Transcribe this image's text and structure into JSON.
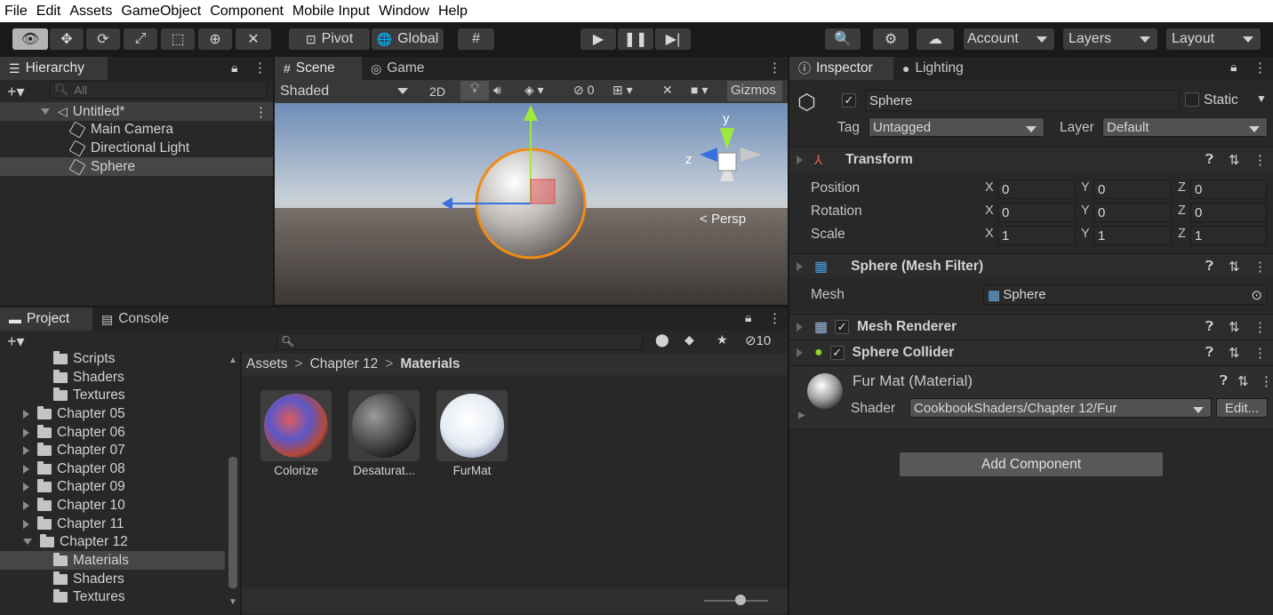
{
  "menu": [
    "File",
    "Edit",
    "Assets",
    "GameObject",
    "Component",
    "Mobile Input",
    "Window",
    "Help"
  ],
  "toolbar": {
    "pivot": "Pivot",
    "global": "Global",
    "account": "Account",
    "layers": "Layers",
    "layout": "Layout"
  },
  "hierarchy": {
    "tab": "Hierarchy",
    "search_placeholder": "All",
    "scene": "Untitled*",
    "items": [
      "Main Camera",
      "Directional Light",
      "Sphere"
    ]
  },
  "scene_view": {
    "tabs": [
      "Scene",
      "Game"
    ],
    "shading": "Shaded",
    "mode_2d": "2D",
    "hidden_count": "0",
    "gizmos": "Gizmos",
    "persp": "Persp",
    "axis_y": "y",
    "axis_z": "z"
  },
  "project": {
    "tabs": [
      "Project",
      "Console"
    ],
    "hidden_count": "10",
    "tree": [
      {
        "label": "Scripts",
        "level": 2
      },
      {
        "label": "Shaders",
        "level": 2
      },
      {
        "label": "Textures",
        "level": 2
      },
      {
        "label": "Chapter 05",
        "level": 1
      },
      {
        "label": "Chapter 06",
        "level": 1
      },
      {
        "label": "Chapter 07",
        "level": 1
      },
      {
        "label": "Chapter 08",
        "level": 1
      },
      {
        "label": "Chapter 09",
        "level": 1
      },
      {
        "label": "Chapter 10",
        "level": 1
      },
      {
        "label": "Chapter 11",
        "level": 1
      },
      {
        "label": "Chapter 12",
        "level": 1
      },
      {
        "label": "Materials",
        "level": 2
      },
      {
        "label": "Shaders",
        "level": 2
      },
      {
        "label": "Textures",
        "level": 2
      }
    ],
    "breadcrumb": [
      "Assets",
      "Chapter 12",
      "Materials"
    ],
    "assets": [
      "Colorize",
      "Desaturat...",
      "FurMat"
    ]
  },
  "inspector": {
    "tabs": [
      "Inspector",
      "Lighting"
    ],
    "object_name": "Sphere",
    "static_label": "Static",
    "tag_label": "Tag",
    "tag_value": "Untagged",
    "layer_label": "Layer",
    "layer_value": "Default",
    "transform": {
      "title": "Transform",
      "rows": [
        {
          "label": "Position",
          "x": "0",
          "y": "0",
          "z": "0"
        },
        {
          "label": "Rotation",
          "x": "0",
          "y": "0",
          "z": "0"
        },
        {
          "label": "Scale",
          "x": "1",
          "y": "1",
          "z": "1"
        }
      ],
      "axis_x": "X",
      "axis_y": "Y",
      "axis_z": "Z"
    },
    "mesh_filter": {
      "title": "Sphere (Mesh Filter)",
      "mesh_label": "Mesh",
      "mesh_value": "Sphere"
    },
    "mesh_renderer": {
      "title": "Mesh Renderer"
    },
    "sphere_collider": {
      "title": "Sphere Collider"
    },
    "material": {
      "title": "Fur Mat (Material)",
      "shader_label": "Shader",
      "shader_value": "CookbookShaders/Chapter 12/Fur",
      "edit": "Edit..."
    },
    "add_component": "Add Component"
  },
  "colors": {
    "selection": "#2c5d87",
    "accent": "#3a79bb",
    "panel": "#282828"
  }
}
